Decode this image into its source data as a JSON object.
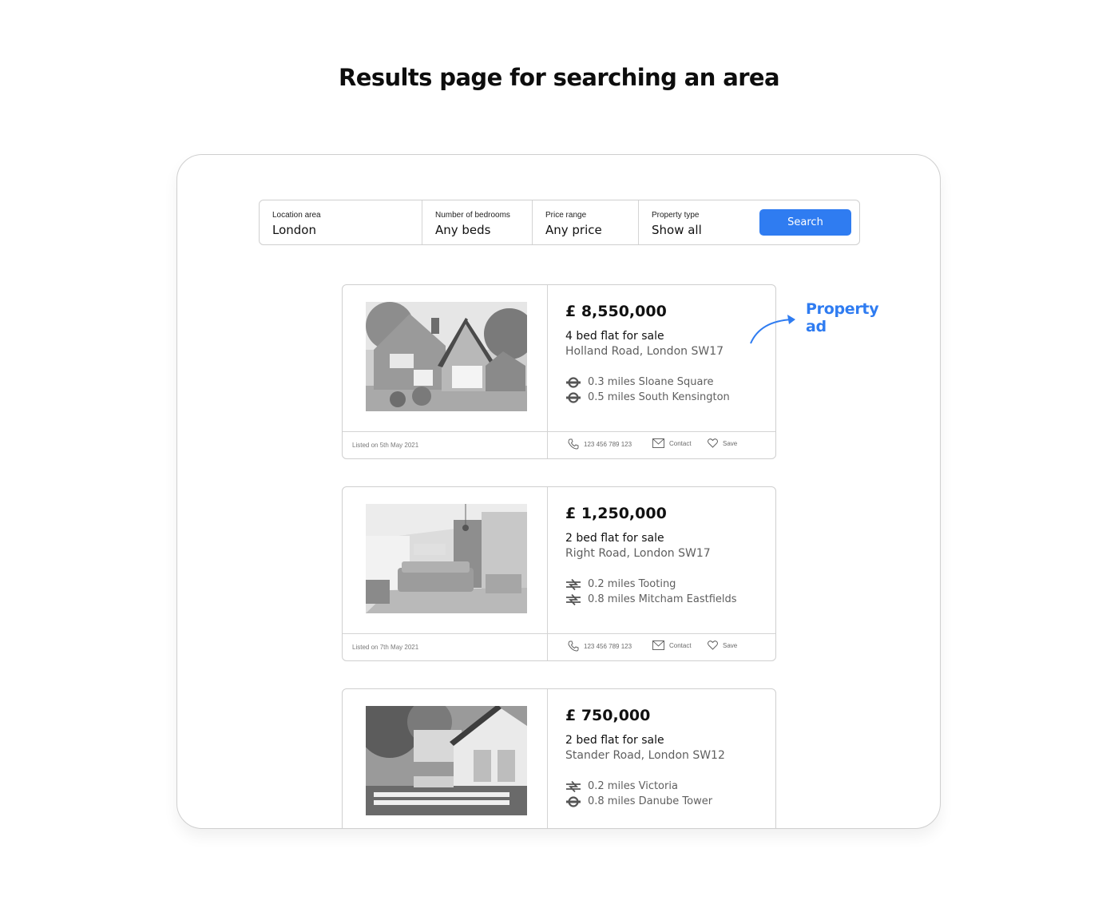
{
  "heading": "Results page for searching an area",
  "search": {
    "fields": [
      {
        "label": "Location area",
        "value": "London"
      },
      {
        "label": "Number of bedrooms",
        "value": "Any beds"
      },
      {
        "label": "Price range",
        "value": "Any price"
      },
      {
        "label": "Property type",
        "value": "Show all"
      }
    ],
    "button_label": "Search"
  },
  "annotation": {
    "line1": "Property",
    "line2": "ad"
  },
  "colors": {
    "accent": "#2f7cf1",
    "border": "#cfcfcf",
    "muted_text": "#5f5f5f"
  },
  "listings": [
    {
      "price": "£ 8,550,000",
      "title": "4 bed flat for sale",
      "address": "Holland Road, London SW17",
      "stations": [
        {
          "icon": "underground-icon",
          "text": "0.3 miles Sloane Square"
        },
        {
          "icon": "underground-icon",
          "text": "0.5 miles South Kensington"
        }
      ],
      "listed": "Listed on 5th May 2021",
      "phone": "123 456 789 123",
      "contact": "Contact",
      "save": "Save"
    },
    {
      "price": "£ 1,250,000",
      "title": "2 bed flat for sale",
      "address": "Right Road, London SW17",
      "stations": [
        {
          "icon": "national-rail-icon",
          "text": "0.2 miles Tooting"
        },
        {
          "icon": "national-rail-icon",
          "text": "0.8 miles Mitcham Eastfields"
        }
      ],
      "listed": "Listed on 7th May 2021",
      "phone": "123 456 789 123",
      "contact": "Contact",
      "save": "Save"
    },
    {
      "price": "£ 750,000",
      "title": "2 bed flat for sale",
      "address": "Stander Road, London SW12",
      "stations": [
        {
          "icon": "national-rail-icon",
          "text": "0.2 miles Victoria"
        },
        {
          "icon": "underground-icon",
          "text": "0.8 miles Danube Tower"
        }
      ]
    }
  ]
}
